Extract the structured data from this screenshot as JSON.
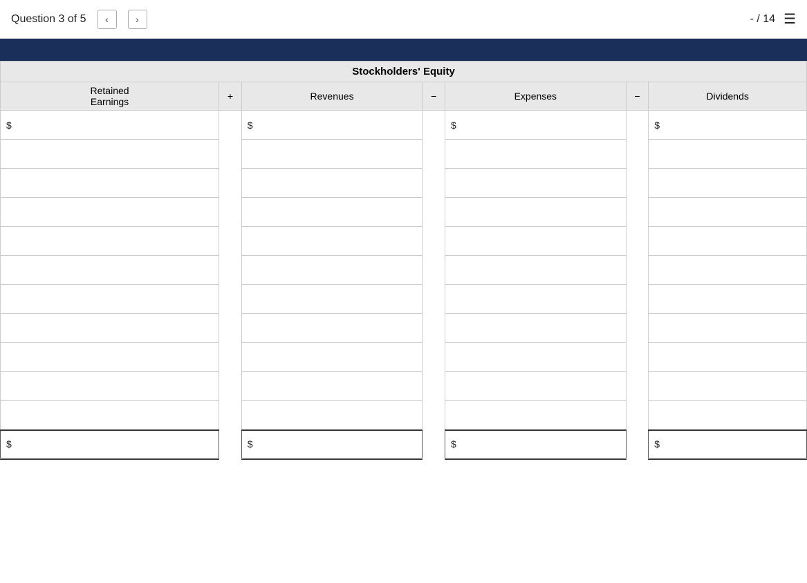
{
  "nav": {
    "question_label": "Question 3 of 5",
    "prev_label": "<",
    "next_label": ">",
    "score_label": "- / 14",
    "menu_icon": "☰"
  },
  "table": {
    "title": "Stockholders' Equity",
    "columns": [
      {
        "id": "retained",
        "label": "Retained\nEarnings",
        "operator": "",
        "has_dollar": true
      },
      {
        "id": "op1",
        "label": "+",
        "operator": true
      },
      {
        "id": "revenues",
        "label": "Revenues",
        "operator": "",
        "has_dollar": true
      },
      {
        "id": "op2",
        "label": "−",
        "operator": true
      },
      {
        "id": "expenses",
        "label": "Expenses",
        "operator": "",
        "has_dollar": true
      },
      {
        "id": "op3",
        "label": "−",
        "operator": true
      },
      {
        "id": "dividends",
        "label": "Dividends",
        "operator": "",
        "has_dollar": true
      }
    ],
    "data_rows": 11,
    "total_row": {
      "has_dollar": true
    }
  }
}
